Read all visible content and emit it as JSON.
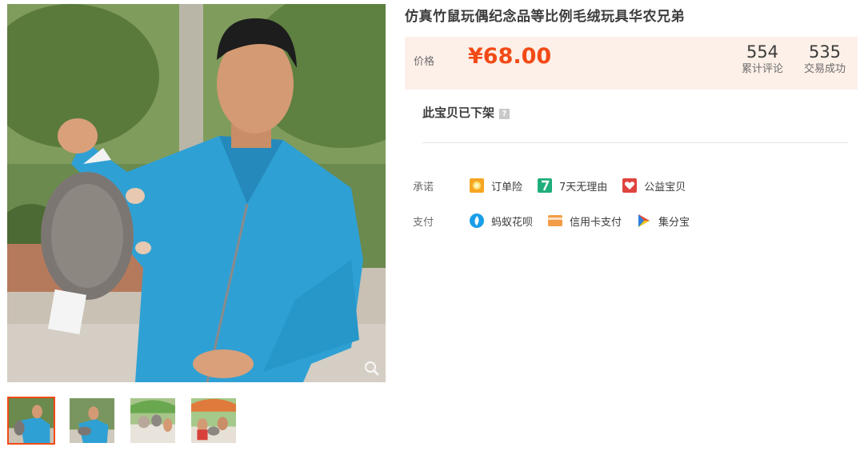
{
  "product": {
    "title": "仿真竹鼠玩偶纪念品等比例毛绒玩具华农兄弟",
    "status_text": "此宝贝已下架",
    "help_mark": "?"
  },
  "price": {
    "label": "价格",
    "value": "¥68.00",
    "color": "#f24a16"
  },
  "stats": {
    "reviews_count": "554",
    "reviews_label": "累计评论",
    "sold_count": "535",
    "sold_label": "交易成功"
  },
  "promise": {
    "label": "承诺",
    "items": [
      {
        "icon": "order-insurance-icon",
        "label": "订单险"
      },
      {
        "icon": "seven-day-return-icon",
        "label": "7天无理由"
      },
      {
        "icon": "charity-icon",
        "label": "公益宝贝"
      }
    ]
  },
  "payment": {
    "label": "支付",
    "items": [
      {
        "icon": "ant-credit-icon",
        "label": "蚂蚁花呗"
      },
      {
        "icon": "credit-card-icon",
        "label": "信用卡支付"
      },
      {
        "icon": "jifenbao-icon",
        "label": "集分宝"
      }
    ]
  },
  "gallery": {
    "thumbnail_count": 4,
    "active_thumbnail": 1
  }
}
